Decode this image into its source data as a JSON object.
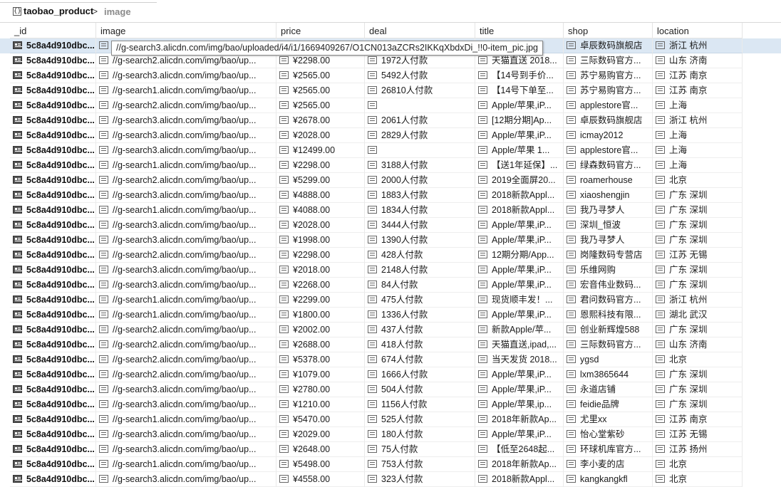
{
  "breadcrumb": {
    "collection": "taobao_product",
    "separator": ">",
    "field": "image",
    "collection_icon": "object-braces-icon"
  },
  "columns": [
    "_id",
    "image",
    "price",
    "deal",
    "title",
    "shop",
    "location"
  ],
  "tooltip": {
    "text": "//g-search3.alicdn.com/img/bao/uploaded/i4/i1/1669409267/O1CN013aZCRs2IKKqXbdxDi_!!0-item_pic.jpg"
  },
  "selected_row": 0,
  "rows": [
    {
      "id": "5c8a4d910dbc...",
      "image": "//g-search3.alicdn.com/img/bao/up...",
      "price": "",
      "deal": "",
      "title": "",
      "shop": "卓辰数码旗舰店",
      "location": "浙江 杭州"
    },
    {
      "id": "5c8a4d910dbc...",
      "image": "//g-search2.alicdn.com/img/bao/up...",
      "price": "¥2298.00",
      "deal": "1972人付款",
      "title": "天猫直送 2018...",
      "shop": "三际数码官方...",
      "location": "山东 济南"
    },
    {
      "id": "5c8a4d910dbc...",
      "image": "//g-search3.alicdn.com/img/bao/up...",
      "price": "¥2565.00",
      "deal": "5492人付款",
      "title": "【14号到手价...",
      "shop": "苏宁易购官方...",
      "location": "江苏 南京"
    },
    {
      "id": "5c8a4d910dbc...",
      "image": "//g-search1.alicdn.com/img/bao/up...",
      "price": "¥2565.00",
      "deal": "26810人付款",
      "title": "【14号下单至...",
      "shop": "苏宁易购官方...",
      "location": "江苏 南京"
    },
    {
      "id": "5c8a4d910dbc...",
      "image": "//g-search2.alicdn.com/img/bao/up...",
      "price": "¥2565.00",
      "deal": "",
      "title": "Apple/苹果,iP...",
      "shop": "applestore官...",
      "location": "上海"
    },
    {
      "id": "5c8a4d910dbc...",
      "image": "//g-search3.alicdn.com/img/bao/up...",
      "price": "¥2678.00",
      "deal": "2061人付款",
      "title": "[12期分期]Ap...",
      "shop": "卓辰数码旗舰店",
      "location": "浙江 杭州"
    },
    {
      "id": "5c8a4d910dbc...",
      "image": "//g-search3.alicdn.com/img/bao/up...",
      "price": "¥2028.00",
      "deal": "2829人付款",
      "title": "Apple/苹果,iP...",
      "shop": "icmay2012",
      "location": "上海"
    },
    {
      "id": "5c8a4d910dbc...",
      "image": "//g-search3.alicdn.com/img/bao/up...",
      "price": "¥12499.00",
      "deal": "",
      "title": "Apple/苹果 1...",
      "shop": "applestore官...",
      "location": "上海"
    },
    {
      "id": "5c8a4d910dbc...",
      "image": "//g-search1.alicdn.com/img/bao/up...",
      "price": "¥2298.00",
      "deal": "3188人付款",
      "title": "【送1年延保】...",
      "shop": "绿森数码官方...",
      "location": "上海"
    },
    {
      "id": "5c8a4d910dbc...",
      "image": "//g-search2.alicdn.com/img/bao/up...",
      "price": "¥5299.00",
      "deal": "2000人付款",
      "title": "2019全面屏20...",
      "shop": "roamerhouse",
      "location": "北京"
    },
    {
      "id": "5c8a4d910dbc...",
      "image": "//g-search3.alicdn.com/img/bao/up...",
      "price": "¥4888.00",
      "deal": "1883人付款",
      "title": "2018新款Appl...",
      "shop": "xiaoshengjin",
      "location": "广东 深圳"
    },
    {
      "id": "5c8a4d910dbc...",
      "image": "//g-search1.alicdn.com/img/bao/up...",
      "price": "¥4088.00",
      "deal": "1834人付款",
      "title": "2018新款Appl...",
      "shop": "我乃寻梦人",
      "location": "广东 深圳"
    },
    {
      "id": "5c8a4d910dbc...",
      "image": "//g-search3.alicdn.com/img/bao/up...",
      "price": "¥2028.00",
      "deal": "3444人付款",
      "title": "Apple/苹果,iP...",
      "shop": "深圳_恒波",
      "location": "广东 深圳"
    },
    {
      "id": "5c8a4d910dbc...",
      "image": "//g-search3.alicdn.com/img/bao/up...",
      "price": "¥1998.00",
      "deal": "1390人付款",
      "title": "Apple/苹果,iP...",
      "shop": "我乃寻梦人",
      "location": "广东 深圳"
    },
    {
      "id": "5c8a4d910dbc...",
      "image": "//g-search2.alicdn.com/img/bao/up...",
      "price": "¥2298.00",
      "deal": "428人付款",
      "title": "12期分期/App...",
      "shop": "岗隆数码专营店",
      "location": "江苏 无锡"
    },
    {
      "id": "5c8a4d910dbc...",
      "image": "//g-search3.alicdn.com/img/bao/up...",
      "price": "¥2018.00",
      "deal": "2148人付款",
      "title": "Apple/苹果,iP...",
      "shop": "乐维网购",
      "location": "广东 深圳"
    },
    {
      "id": "5c8a4d910dbc...",
      "image": "//g-search3.alicdn.com/img/bao/up...",
      "price": "¥2268.00",
      "deal": "84人付款",
      "title": "Apple/苹果,iP...",
      "shop": "宏音伟业数码...",
      "location": "广东 深圳"
    },
    {
      "id": "5c8a4d910dbc...",
      "image": "//g-search1.alicdn.com/img/bao/up...",
      "price": "¥2299.00",
      "deal": "475人付款",
      "title": "现货顺丰发！...",
      "shop": "君问数码官方...",
      "location": "浙江 杭州"
    },
    {
      "id": "5c8a4d910dbc...",
      "image": "//g-search1.alicdn.com/img/bao/up...",
      "price": "¥1800.00",
      "deal": "1336人付款",
      "title": "Apple/苹果,iP...",
      "shop": "恩熙科技有限...",
      "location": "湖北 武汉"
    },
    {
      "id": "5c8a4d910dbc...",
      "image": "//g-search2.alicdn.com/img/bao/up...",
      "price": "¥2002.00",
      "deal": "437人付款",
      "title": "新款Apple/苹...",
      "shop": "创业新辉煌588",
      "location": "广东 深圳"
    },
    {
      "id": "5c8a4d910dbc...",
      "image": "//g-search2.alicdn.com/img/bao/up...",
      "price": "¥2688.00",
      "deal": "418人付款",
      "title": "天猫直送,ipad,...",
      "shop": "三际数码官方...",
      "location": "山东 济南"
    },
    {
      "id": "5c8a4d910dbc...",
      "image": "//g-search2.alicdn.com/img/bao/up...",
      "price": "¥5378.00",
      "deal": "674人付款",
      "title": "当天发货 2018...",
      "shop": "ygsd",
      "location": "北京"
    },
    {
      "id": "5c8a4d910dbc...",
      "image": "//g-search2.alicdn.com/img/bao/up...",
      "price": "¥1079.00",
      "deal": "1666人付款",
      "title": "Apple/苹果,iP...",
      "shop": "lxm3865644",
      "location": "广东 深圳"
    },
    {
      "id": "5c8a4d910dbc...",
      "image": "//g-search3.alicdn.com/img/bao/up...",
      "price": "¥2780.00",
      "deal": "504人付款",
      "title": "Apple/苹果,iP...",
      "shop": "永道店铺",
      "location": "广东 深圳"
    },
    {
      "id": "5c8a4d910dbc...",
      "image": "//g-search3.alicdn.com/img/bao/up...",
      "price": "¥1210.00",
      "deal": "1156人付款",
      "title": "Apple/苹果,ip...",
      "shop": "feidie品牌",
      "location": "广东 深圳"
    },
    {
      "id": "5c8a4d910dbc...",
      "image": "//g-search1.alicdn.com/img/bao/up...",
      "price": "¥5470.00",
      "deal": "525人付款",
      "title": "2018年新款Ap...",
      "shop": "尤里xx",
      "location": "江苏 南京"
    },
    {
      "id": "5c8a4d910dbc...",
      "image": "//g-search3.alicdn.com/img/bao/up...",
      "price": "¥2029.00",
      "deal": "180人付款",
      "title": "Apple/苹果,iP...",
      "shop": "怡心堂紫砂",
      "location": "江苏 无锡"
    },
    {
      "id": "5c8a4d910dbc...",
      "image": "//g-search3.alicdn.com/img/bao/up...",
      "price": "¥2648.00",
      "deal": "75人付款",
      "title": "【低至2648起...",
      "shop": "环球机库官方...",
      "location": "江苏 扬州"
    },
    {
      "id": "5c8a4d910dbc...",
      "image": "//g-search1.alicdn.com/img/bao/up...",
      "price": "¥5498.00",
      "deal": "753人付款",
      "title": "2018年新款Ap...",
      "shop": "李小麦的店",
      "location": "北京"
    },
    {
      "id": "5c8a4d910dbc...",
      "image": "//g-search3.alicdn.com/img/bao/up...",
      "price": "¥4558.00",
      "deal": "323人付款",
      "title": "2018新款Appl...",
      "shop": "kangkangkfl",
      "location": "北京"
    }
  ]
}
